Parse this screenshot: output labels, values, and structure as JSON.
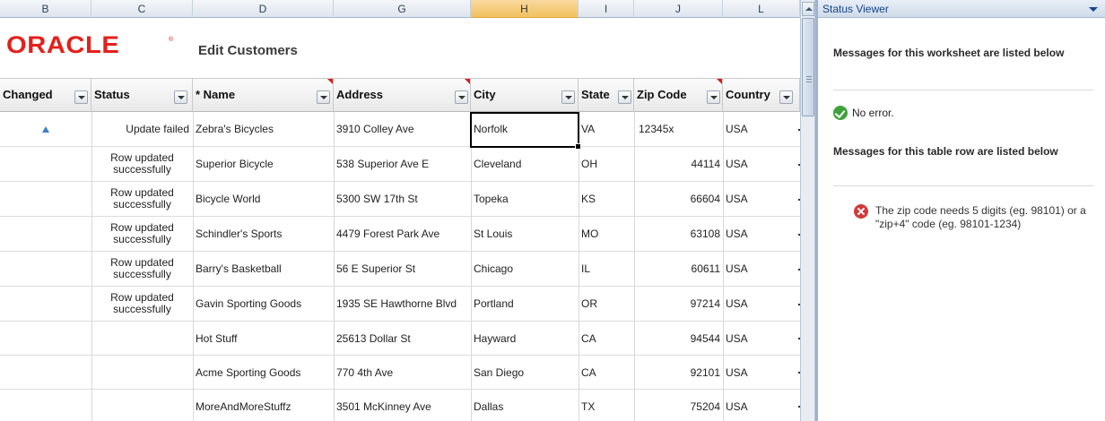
{
  "column_headers": [
    "B",
    "C",
    "D",
    "G",
    "H",
    "I",
    "J",
    "L"
  ],
  "selected_column": "H",
  "banner": {
    "logo": "ORACLE",
    "title": "Edit Customers"
  },
  "table": {
    "headers": [
      "Changed",
      "Status",
      "* Name",
      "Address",
      "City",
      "State",
      "Zip Code",
      "Country"
    ],
    "rows": [
      {
        "changed": true,
        "status": "Update failed",
        "name": "Zebra's Bicycles",
        "address": "3910 Colley Ave",
        "city": "Norfolk",
        "state": "VA",
        "zip": "12345x",
        "country": "USA"
      },
      {
        "changed": false,
        "status": "Row updated successfully",
        "name": "Superior Bicycle",
        "address": "538 Superior Ave E",
        "city": "Cleveland",
        "state": "OH",
        "zip": "44114",
        "country": "USA"
      },
      {
        "changed": false,
        "status": "Row updated successfully",
        "name": "Bicycle World",
        "address": "5300 SW 17th St",
        "city": "Topeka",
        "state": "KS",
        "zip": "66604",
        "country": "USA"
      },
      {
        "changed": false,
        "status": "Row updated successfully",
        "name": "Schindler's Sports",
        "address": "4479 Forest Park Ave",
        "city": "St Louis",
        "state": "MO",
        "zip": "63108",
        "country": "USA"
      },
      {
        "changed": false,
        "status": "Row updated successfully",
        "name": "Barry's Basketball",
        "address": "56 E Superior St",
        "city": "Chicago",
        "state": "IL",
        "zip": "60611",
        "country": "USA"
      },
      {
        "changed": false,
        "status": "Row updated successfully",
        "name": "Gavin Sporting Goods",
        "address": "1935 SE Hawthorne Blvd",
        "city": "Portland",
        "state": "OR",
        "zip": "97214",
        "country": "USA"
      },
      {
        "changed": false,
        "status": "",
        "name": "Hot Stuff",
        "address": "25613 Dollar St",
        "city": "Hayward",
        "state": "CA",
        "zip": "94544",
        "country": "USA"
      },
      {
        "changed": false,
        "status": "",
        "name": "Acme Sporting Goods",
        "address": "770 4th Ave",
        "city": "San Diego",
        "state": "CA",
        "zip": "92101",
        "country": "USA"
      },
      {
        "changed": false,
        "status": "",
        "name": "MoreAndMoreStuffz",
        "address": "3501 McKinney Ave",
        "city": "Dallas",
        "state": "TX",
        "zip": "75204",
        "country": "USA"
      }
    ]
  },
  "status_viewer": {
    "title": "Status Viewer",
    "worksheet_heading": "Messages for this worksheet are listed below",
    "worksheet_message": "No error.",
    "row_heading": "Messages for this table row are listed below",
    "row_message": "The zip code needs 5 digits (eg. 98101) or a \"zip+4\" code (eg. 98101-1234)"
  },
  "colors": {
    "oracle_red": "#e2211c",
    "selected_column": "#f1c15f",
    "pane_title": "#15428b",
    "ok": "#3fa23a",
    "error": "#d23a3a"
  }
}
